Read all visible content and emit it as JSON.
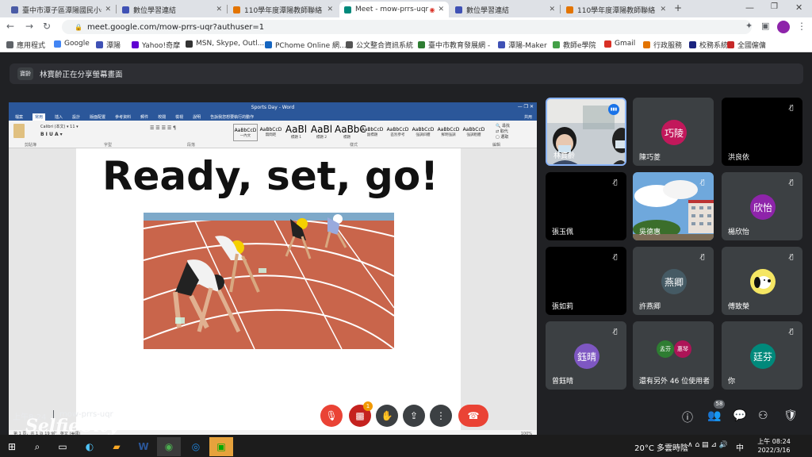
{
  "browser": {
    "tabs": [
      {
        "label": "臺中市潭子區潭陽國民小學",
        "color": "#4a5ba6"
      },
      {
        "label": "數位學習連結",
        "color": "#3f51b5"
      },
      {
        "label": "110學年度潭陽教師聯絡",
        "color": "#e37400"
      },
      {
        "label": "Meet - mow-prrs-uqr",
        "color": "#00897b",
        "active": true
      },
      {
        "label": "數位學習連結",
        "color": "#3f51b5"
      },
      {
        "label": "110學年度潭陽教師聯絡",
        "color": "#e37400"
      }
    ],
    "new_tab": "+",
    "url": "meet.google.com/mow-prrs-uqr?authuser=1",
    "bookmarks": [
      {
        "label": "應用程式",
        "color": "#5f6368"
      },
      {
        "label": "Google",
        "color": "#4285f4"
      },
      {
        "label": "潭陽",
        "color": "#3f51b5"
      },
      {
        "label": "Yahoo!奇摩",
        "color": "#6001d2"
      },
      {
        "label": "MSN, Skype, Outl...",
        "color": "#333333"
      },
      {
        "label": "PChome Online 網...",
        "color": "#1565c0"
      },
      {
        "label": "公文整合資訊系統",
        "color": "#555555"
      },
      {
        "label": "臺中市教育發展網 -",
        "color": "#2e7d32"
      },
      {
        "label": "潭陽-Maker",
        "color": "#3f51b5"
      },
      {
        "label": "教師e學院",
        "color": "#43a047"
      },
      {
        "label": "Gmail",
        "color": "#d93025"
      },
      {
        "label": "行政服務",
        "color": "#e37400"
      },
      {
        "label": "校務系統",
        "color": "#1a237e"
      },
      {
        "label": "全國僱傭",
        "color": "#c62828"
      }
    ]
  },
  "meet": {
    "banner_avatar": "寶齡",
    "banner_text": "林寶齡正在分享螢幕畫面",
    "word": {
      "title": "Sports Day - Word",
      "menu": [
        "檔案",
        "常用",
        "插入",
        "設計",
        "版面配置",
        "參考資料",
        "郵件",
        "校閱",
        "檢視",
        "說明",
        "告訴我您想要執行的動作"
      ],
      "share": "共用",
      "styles": [
        {
          "sample": "AaBbCcD",
          "name": "一內文"
        },
        {
          "sample": "AaBbCcD",
          "name": "無間距"
        },
        {
          "sample": "AaBl",
          "name": "標題 1"
        },
        {
          "sample": "AaBl",
          "name": "標題 2"
        },
        {
          "sample": "AaBbC",
          "name": "標題"
        },
        {
          "sample": "AaBbCcD",
          "name": "副標題"
        },
        {
          "sample": "AaBbCcD",
          "name": "區別參考"
        },
        {
          "sample": "AaBbCcD",
          "name": "強調斜體"
        },
        {
          "sample": "AaBbCcD",
          "name": "鮮明強調"
        },
        {
          "sample": "AaBbCcD",
          "name": "強調粗體"
        }
      ],
      "groups": [
        "剪貼簿",
        "字型",
        "段落",
        "樣式",
        "編輯"
      ],
      "doc_heading": "Ready, set, go!",
      "status": "第 1 頁，共 1 頁    19 個字    英文 (美國)",
      "zoom": "100%"
    },
    "tiles": [
      {
        "name": "林寶齡",
        "type": "video",
        "speaking": true
      },
      {
        "name": "陳巧菱",
        "type": "avatar",
        "initials": "巧陵",
        "color": "#c2185b"
      },
      {
        "name": "洪良依",
        "type": "dark",
        "muted": true
      },
      {
        "name": "張玉佩",
        "type": "dark",
        "muted": true
      },
      {
        "name": "吳德惠",
        "type": "building",
        "muted": true
      },
      {
        "name": "楊欣怡",
        "type": "avatar",
        "initials": "欣怡",
        "color": "#8e24aa",
        "muted": true
      },
      {
        "name": "張如莉",
        "type": "dark",
        "muted": true
      },
      {
        "name": "許燕卿",
        "type": "avatar",
        "initials": "燕卿",
        "color": "#455a64",
        "muted": true
      },
      {
        "name": "傅致榮",
        "type": "snoopy",
        "muted": true
      },
      {
        "name": "曾鈺晴",
        "type": "avatar",
        "initials": "鈺晴",
        "color": "#7e57c2",
        "muted": true
      },
      {
        "name": "還有另外 46 位使用者",
        "type": "more",
        "a": "孟芬",
        "b": "惠琴"
      },
      {
        "name": "你",
        "type": "avatar",
        "initials": "廷芬",
        "color": "#00897b",
        "muted": true
      }
    ],
    "time": "上午8:24",
    "meeting_code": "mow-prrs-uqr",
    "people_count": "58",
    "notify_count": "1",
    "watermark": "SelfieCity"
  },
  "taskbar": {
    "weather": "20°C  多雲時陰",
    "ime": "中",
    "clock_time": "上午 08:24",
    "clock_date": "2022/3/16"
  }
}
